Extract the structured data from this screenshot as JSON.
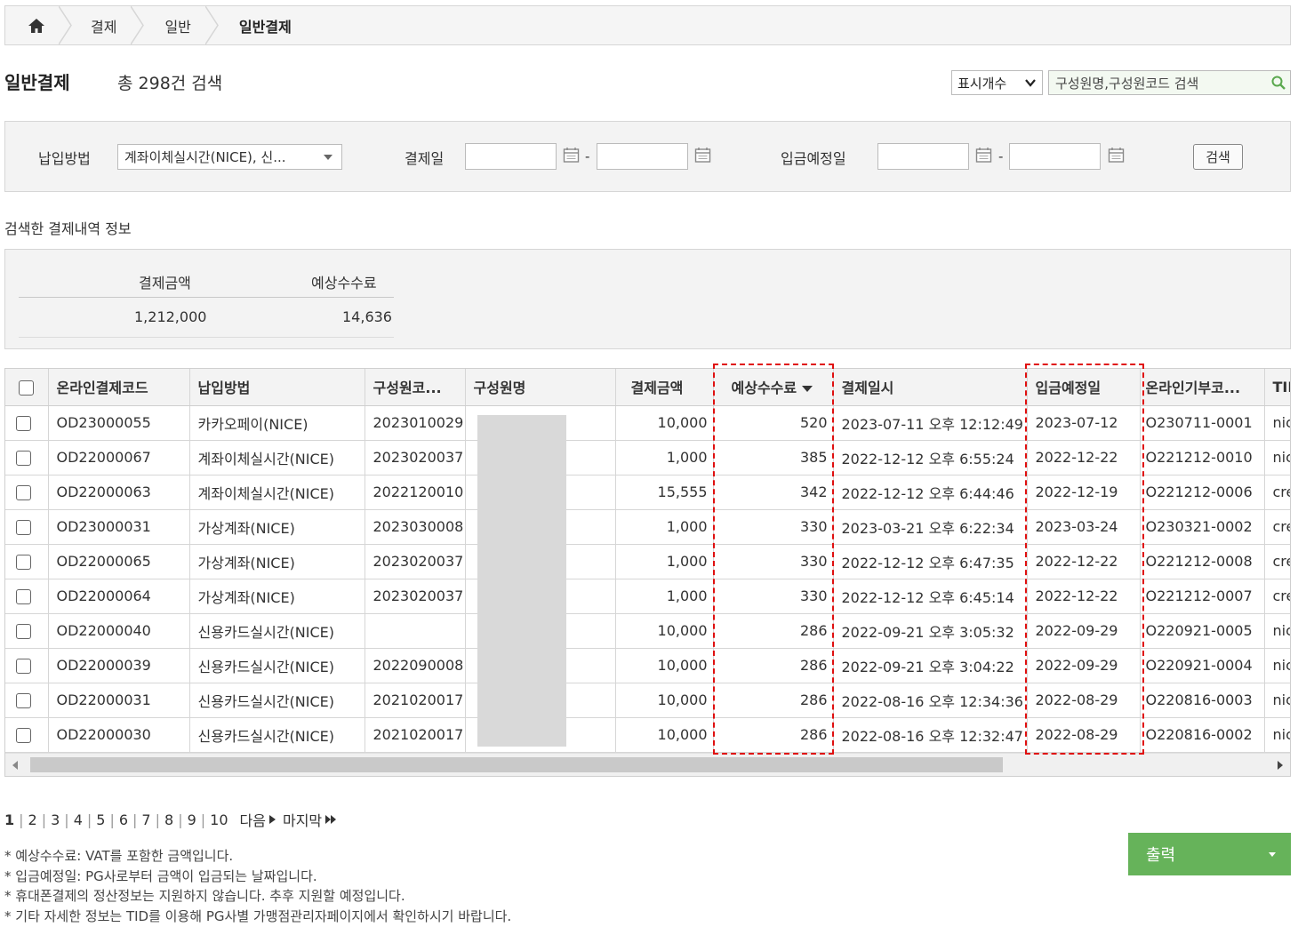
{
  "breadcrumb": {
    "home_icon": "home-icon",
    "items": [
      "결제",
      "일반",
      "일반결제"
    ]
  },
  "header": {
    "title": "일반결제",
    "total": "총 298건 검색",
    "display_select": "표시개수",
    "search_placeholder": "구성원명,구성원코드 검색"
  },
  "filters": {
    "payment_method_label": "납입방법",
    "payment_method_value": "계좌이체실시간(NICE), 신...",
    "payment_date_label": "결제일",
    "deposit_date_label": "입금예정일",
    "date_separator": "-",
    "search_button": "검색"
  },
  "summary": {
    "heading": "검색한 결제내역 정보",
    "amount_label": "결제금액",
    "fee_label": "예상수수료",
    "amount_value": "1,212,000",
    "fee_value": "14,636"
  },
  "table": {
    "columns": [
      "온라인결제코드",
      "납입방법",
      "구성원코...",
      "구성원명",
      "결제금액",
      "예상수수료",
      "결제일시",
      "입금예정일",
      "온라인기부코...",
      "TID"
    ],
    "rows": [
      {
        "code": "OD23000055",
        "method": "카카오페이(NICE)",
        "member_code": "2023010029",
        "member_name": "",
        "amount": "10,000",
        "fee": "520",
        "paid_at": "2023-07-11 오후 12:12:49",
        "deposit_date": "2023-07-12",
        "donation_code": "O230711-0001",
        "tid": "nic"
      },
      {
        "code": "OD22000067",
        "method": "계좌이체실시간(NICE)",
        "member_code": "2023020037",
        "member_name": "",
        "amount": "1,000",
        "fee": "385",
        "paid_at": "2022-12-12 오후 6:55:24",
        "deposit_date": "2022-12-22",
        "donation_code": "O221212-0010",
        "tid": "nic"
      },
      {
        "code": "OD22000063",
        "method": "계좌이체실시간(NICE)",
        "member_code": "2022120010",
        "member_name": "",
        "amount": "15,555",
        "fee": "342",
        "paid_at": "2022-12-12 오후 6:44:46",
        "deposit_date": "2022-12-19",
        "donation_code": "O221212-0006",
        "tid": "cre"
      },
      {
        "code": "OD23000031",
        "method": "가상계좌(NICE)",
        "member_code": "2023030008",
        "member_name": "",
        "amount": "1,000",
        "fee": "330",
        "paid_at": "2023-03-21 오후 6:22:34",
        "deposit_date": "2023-03-24",
        "donation_code": "O230321-0002",
        "tid": "cre"
      },
      {
        "code": "OD22000065",
        "method": "가상계좌(NICE)",
        "member_code": "2023020037",
        "member_name": "",
        "amount": "1,000",
        "fee": "330",
        "paid_at": "2022-12-12 오후 6:47:35",
        "deposit_date": "2022-12-22",
        "donation_code": "O221212-0008",
        "tid": "cre"
      },
      {
        "code": "OD22000064",
        "method": "가상계좌(NICE)",
        "member_code": "2023020037",
        "member_name": "",
        "amount": "1,000",
        "fee": "330",
        "paid_at": "2022-12-12 오후 6:45:14",
        "deposit_date": "2022-12-22",
        "donation_code": "O221212-0007",
        "tid": "cre"
      },
      {
        "code": "OD22000040",
        "method": "신용카드실시간(NICE)",
        "member_code": "",
        "member_name": "",
        "amount": "10,000",
        "fee": "286",
        "paid_at": "2022-09-21 오후 3:05:32",
        "deposit_date": "2022-09-29",
        "donation_code": "O220921-0005",
        "tid": "nic"
      },
      {
        "code": "OD22000039",
        "method": "신용카드실시간(NICE)",
        "member_code": "2022090008",
        "member_name": "",
        "amount": "10,000",
        "fee": "286",
        "paid_at": "2022-09-21 오후 3:04:22",
        "deposit_date": "2022-09-29",
        "donation_code": "O220921-0004",
        "tid": "nic"
      },
      {
        "code": "OD22000031",
        "method": "신용카드실시간(NICE)",
        "member_code": "2021020017",
        "member_name": "",
        "amount": "10,000",
        "fee": "286",
        "paid_at": "2022-08-16 오후 12:34:36",
        "deposit_date": "2022-08-29",
        "donation_code": "O220816-0003",
        "tid": "nic"
      },
      {
        "code": "OD22000030",
        "method": "신용카드실시간(NICE)",
        "member_code": "2021020017",
        "member_name": "",
        "amount": "10,000",
        "fee": "286",
        "paid_at": "2022-08-16 오후 12:32:47",
        "deposit_date": "2022-08-29",
        "donation_code": "O220816-0002",
        "tid": "nic"
      }
    ]
  },
  "pagination": {
    "pages": [
      "1",
      "2",
      "3",
      "4",
      "5",
      "6",
      "7",
      "8",
      "9",
      "10"
    ],
    "current": "1",
    "next": "다음",
    "last": "마지막"
  },
  "notes": [
    "* 예상수수료: VAT를 포함한 금액입니다.",
    "* 입금예정일: PG사로부터 금액이 입금되는 날짜입니다.",
    "* 휴대폰결제의 정산정보는 지원하지 않습니다. 추후 지원할 예정입니다.",
    "* 기타 자세한 정보는 TID를 이용해 PG사별 가맹점관리자페이지에서 확인하시기 바랍니다."
  ],
  "print_button": "출력",
  "colors": {
    "accent_green": "#66b35a",
    "highlight_red": "#e01010",
    "panel_bg": "#f3f3f3"
  }
}
